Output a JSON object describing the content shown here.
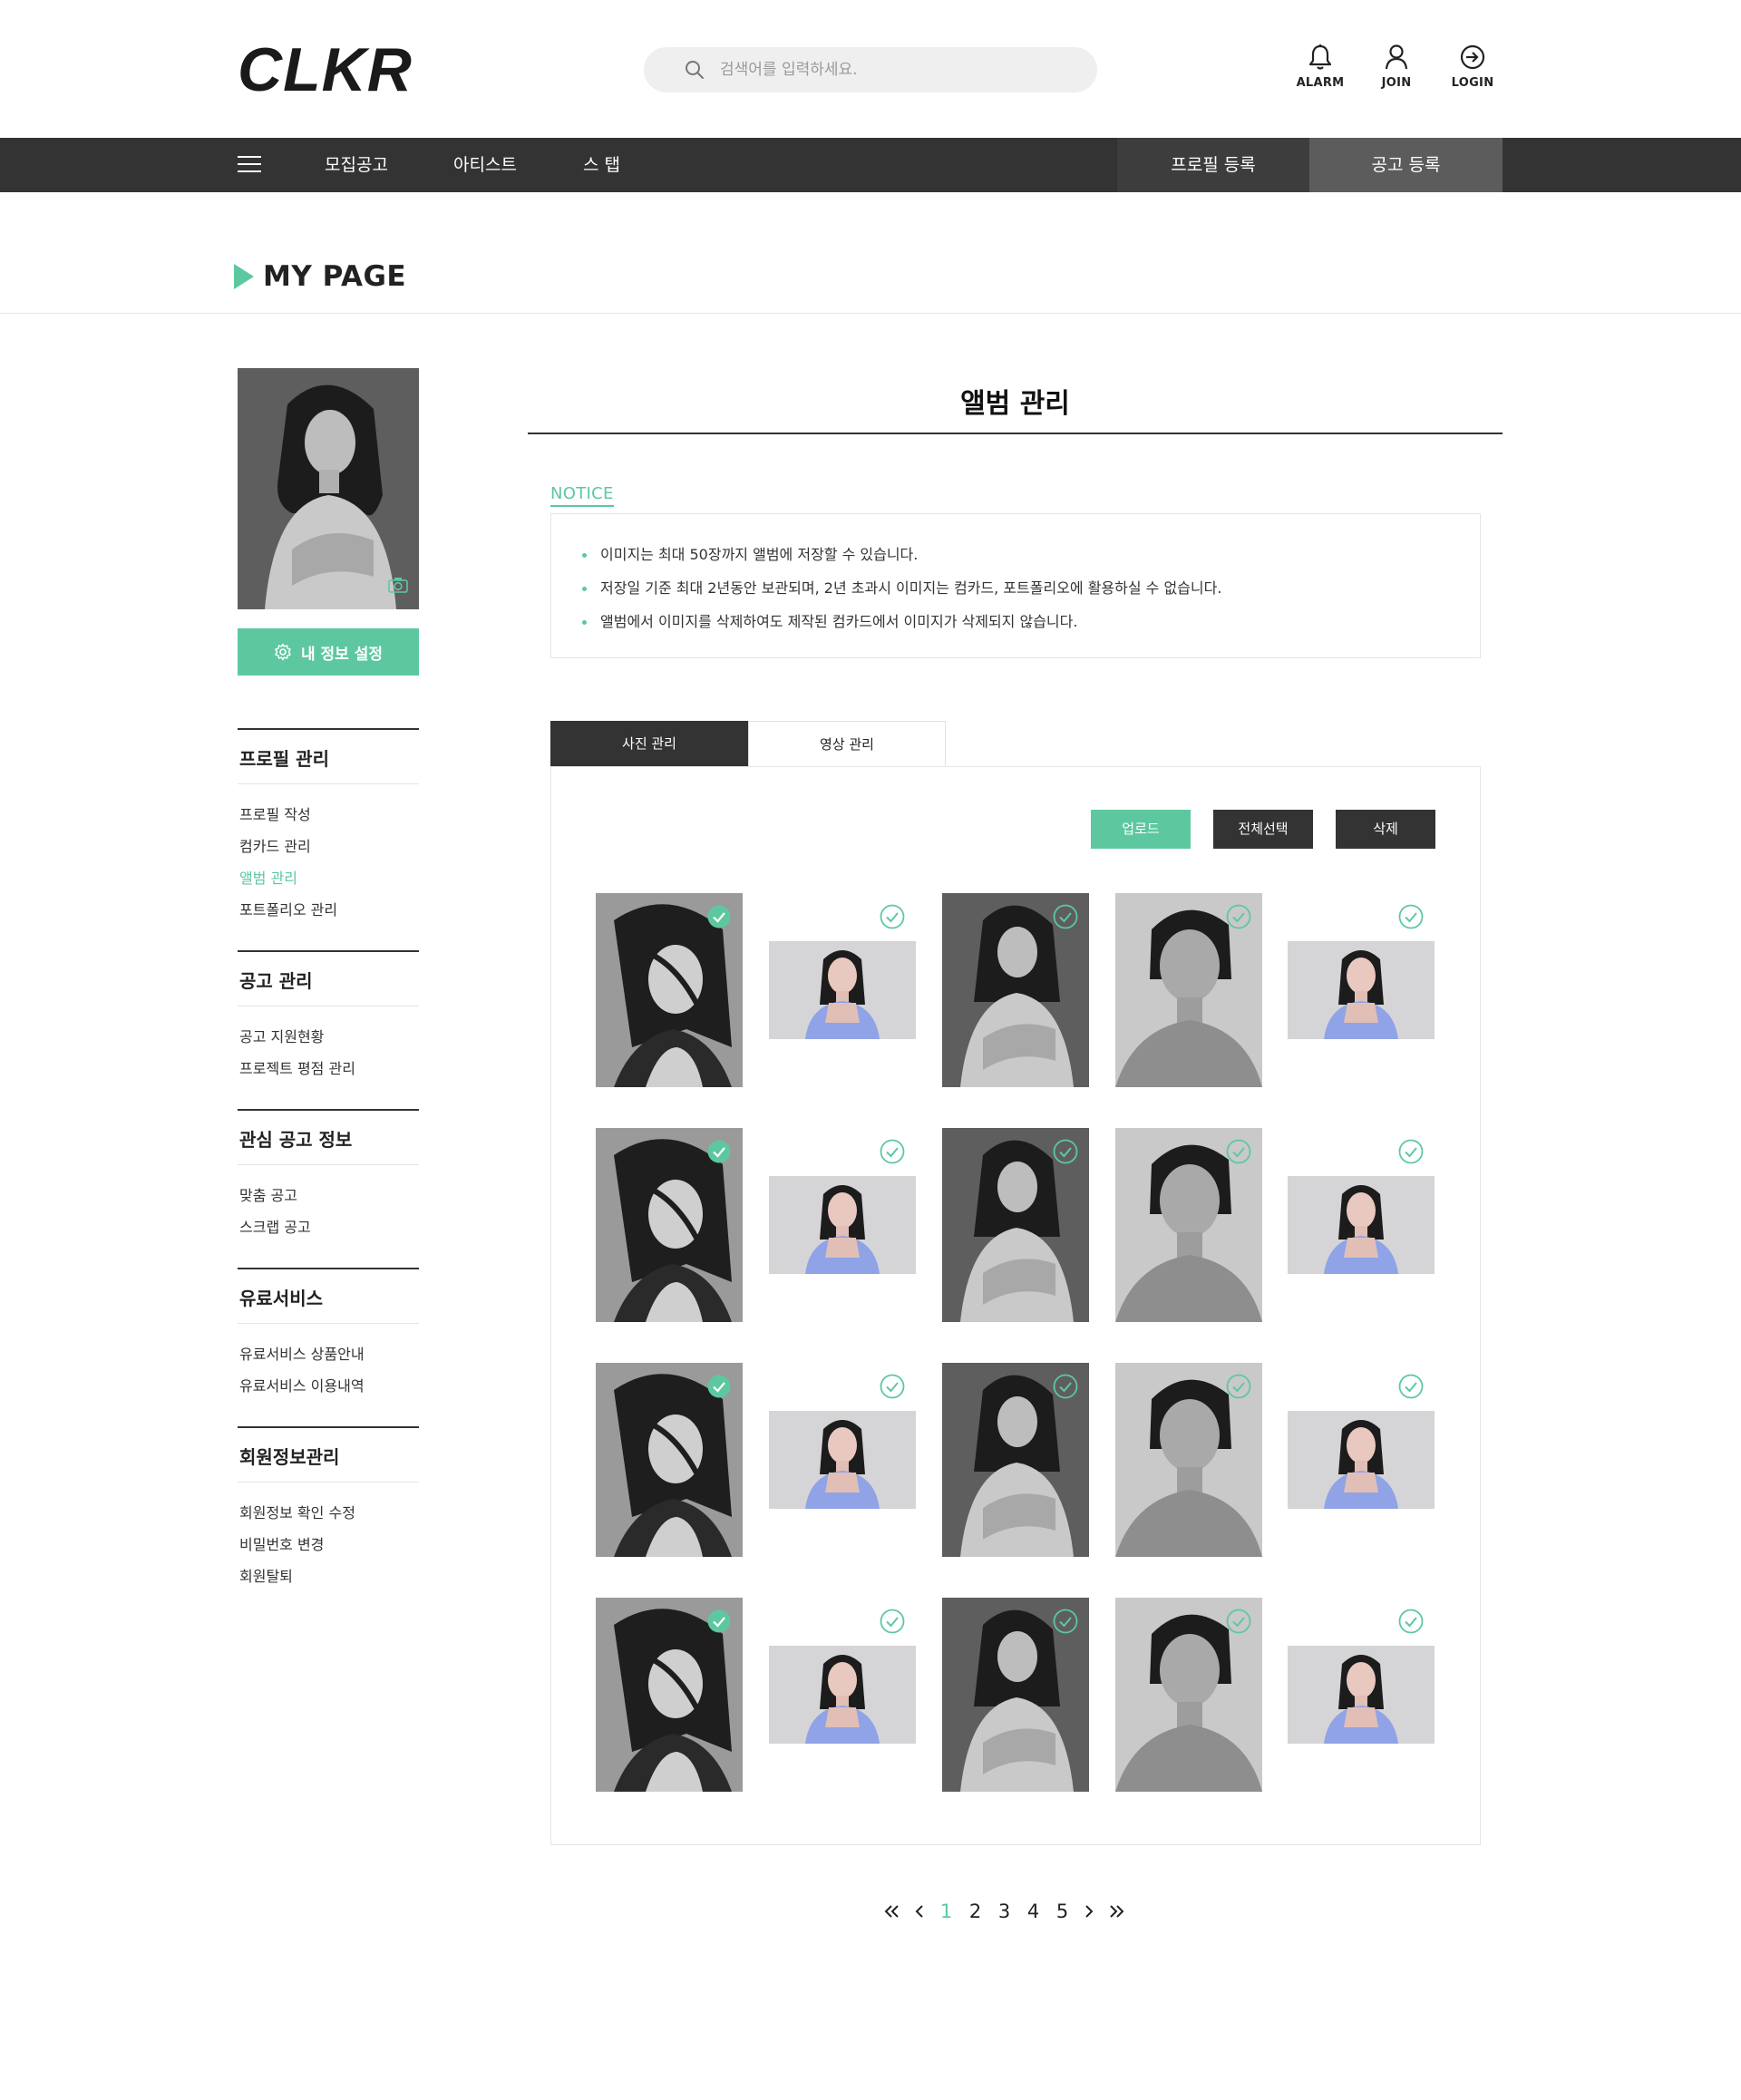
{
  "header": {
    "logo": "CLKR",
    "search_placeholder": "검색어를 입력하세요.",
    "utils": [
      {
        "label": "ALARM",
        "icon": "bell-icon"
      },
      {
        "label": "JOIN",
        "icon": "user-icon"
      },
      {
        "label": "LOGIN",
        "icon": "login-icon"
      }
    ]
  },
  "nav": {
    "items": [
      "모집공고",
      "아티스트",
      "스 탭"
    ],
    "profile_button": "프로필 등록",
    "post_button": "공고 등록"
  },
  "page": {
    "title": "MY PAGE"
  },
  "sidebar": {
    "settings_button": "내 정보 설정",
    "groups": [
      {
        "title": "프로필 관리",
        "items": [
          "프로필 작성",
          "컴카드 관리",
          "앨범 관리",
          "포트폴리오 관리"
        ],
        "active_index": 2
      },
      {
        "title": "공고 관리",
        "items": [
          "공고 지원현황",
          "프로젝트 평점 관리"
        ]
      },
      {
        "title": "관심 공고 정보",
        "items": [
          "맞춤 공고",
          "스크랩 공고"
        ]
      },
      {
        "title": "유료서비스",
        "items": [
          "유료서비스 상품안내",
          "유료서비스 이용내역"
        ]
      },
      {
        "title": "회원정보관리",
        "items": [
          "회원정보 확인 수정",
          "비밀번호 변경",
          "회원탈퇴"
        ]
      }
    ]
  },
  "main": {
    "title": "앨범 관리",
    "notice_label": "NOTICE",
    "notices": [
      "이미지는 최대 50장까지 앨범에 저장할 수 있습니다.",
      "저장일 기준 최대 2년동안 보관되며, 2년 초과시 이미지는 컴카드, 포트폴리오에 활용하실 수 없습니다.",
      "앨범에서 이미지를 삭제하여도 제작된 컴카드에서 이미지가 삭제되지 않습니다."
    ],
    "tabs": [
      "사진 관리",
      "영상 관리"
    ],
    "actions": {
      "upload": "업로드",
      "select_all": "전체선택",
      "delete": "삭제"
    },
    "accent_color": "#5dc8a0",
    "dark_color": "#333333"
  },
  "pagination": {
    "pages": [
      "1",
      "2",
      "3",
      "4",
      "5"
    ],
    "current": "1"
  }
}
